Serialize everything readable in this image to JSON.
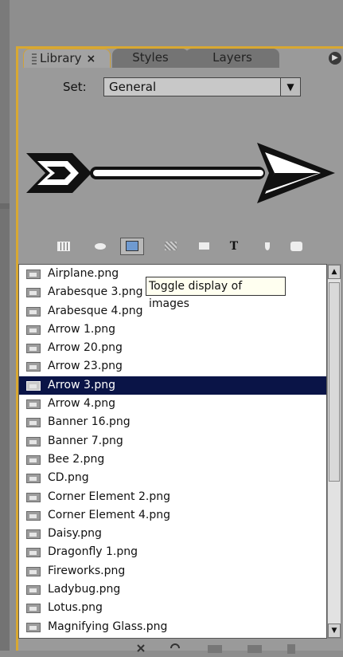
{
  "tabs": [
    {
      "label": "Library",
      "close": "×"
    },
    {
      "label": "Styles"
    },
    {
      "label": "Layers"
    }
  ],
  "set": {
    "label": "Set:",
    "value": "General"
  },
  "toolbar": {
    "buttons": [
      {
        "name": "grid-view-icon"
      },
      {
        "name": "shape-icon"
      },
      {
        "name": "image-icon",
        "active": true
      },
      {
        "name": "texture-icon"
      },
      {
        "name": "folder-icon"
      },
      {
        "name": "text-icon",
        "glyph": "T"
      },
      {
        "name": "brush-icon"
      },
      {
        "name": "download-icon"
      }
    ],
    "tooltip": "Toggle display of images"
  },
  "items": [
    "Airplane.png",
    "Arabesque 3.png",
    "Arabesque 4.png",
    "Arrow 1.png",
    "Arrow 20.png",
    "Arrow 23.png",
    "Arrow 3.png",
    "Arrow 4.png",
    "Banner 16.png",
    "Banner 7.png",
    "Bee 2.png",
    "CD.png",
    "Corner Element 2.png",
    "Corner Element 4.png",
    "Daisy.png",
    "Dragonfly 1.png",
    "Fireworks.png",
    "Ladybug.png",
    "Lotus.png",
    "Magnifying Glass.png"
  ],
  "selected_item": "Arrow 3.png",
  "colors": {
    "accent": "#d8a832",
    "selection": "#0a1447",
    "panel_bg": "#9a9a9a"
  }
}
